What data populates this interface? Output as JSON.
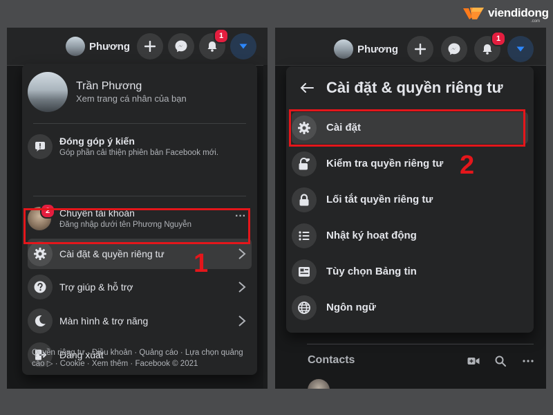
{
  "brand": {
    "name": "viendidong",
    "sub": ".com"
  },
  "left": {
    "topbar": {
      "profile_name": "Phương",
      "notification_count": "1"
    },
    "menu": {
      "profile": {
        "name": "Trần Phương",
        "subtitle": "Xem trang cá nhân của bạn"
      },
      "feedback": {
        "title": "Đóng góp ý kiến",
        "subtitle": "Góp phần cải thiện phiên bản Facebook mới."
      },
      "switch_account": {
        "title": "Chuyển tài khoản",
        "subtitle": "Đăng nhập dưới tên Phương Nguyễn",
        "badge": "2",
        "more": "···"
      },
      "items": [
        {
          "label": "Cài đặt & quyền riêng tư",
          "icon": "gear-icon"
        },
        {
          "label": "Trợ giúp & hỗ trợ",
          "icon": "help-icon"
        },
        {
          "label": "Màn hình & trợ năng",
          "icon": "moon-icon"
        },
        {
          "label": "Đăng xuất",
          "icon": "logout-icon"
        }
      ],
      "footer": "Quyền riêng tư · Điều khoản · Quảng cáo · Lựa chọn quảng cáo ▷ · Cookie · Xem thêm · Facebook © 2021"
    },
    "step_label": "1"
  },
  "right": {
    "topbar": {
      "profile_name": "Phương",
      "notification_count": "1"
    },
    "menu": {
      "title": "Cài đặt & quyền riêng tư",
      "items": [
        {
          "label": "Cài đặt",
          "icon": "gear-icon"
        },
        {
          "label": "Kiểm tra quyền riêng tư",
          "icon": "lock-heart-icon"
        },
        {
          "label": "Lối tắt quyền riêng tư",
          "icon": "lock-icon"
        },
        {
          "label": "Nhật ký hoạt động",
          "icon": "list-icon"
        },
        {
          "label": "Tùy chọn Bảng tin",
          "icon": "news-feed-icon"
        },
        {
          "label": "Ngôn ngữ",
          "icon": "globe-icon"
        }
      ]
    },
    "contacts": {
      "title": "Contacts"
    },
    "step_label": "2"
  },
  "colors": {
    "accent": "#2d88ff",
    "annotation_red": "#e4161b",
    "panel_bg": "#242526",
    "page_bg": "#18191a"
  }
}
